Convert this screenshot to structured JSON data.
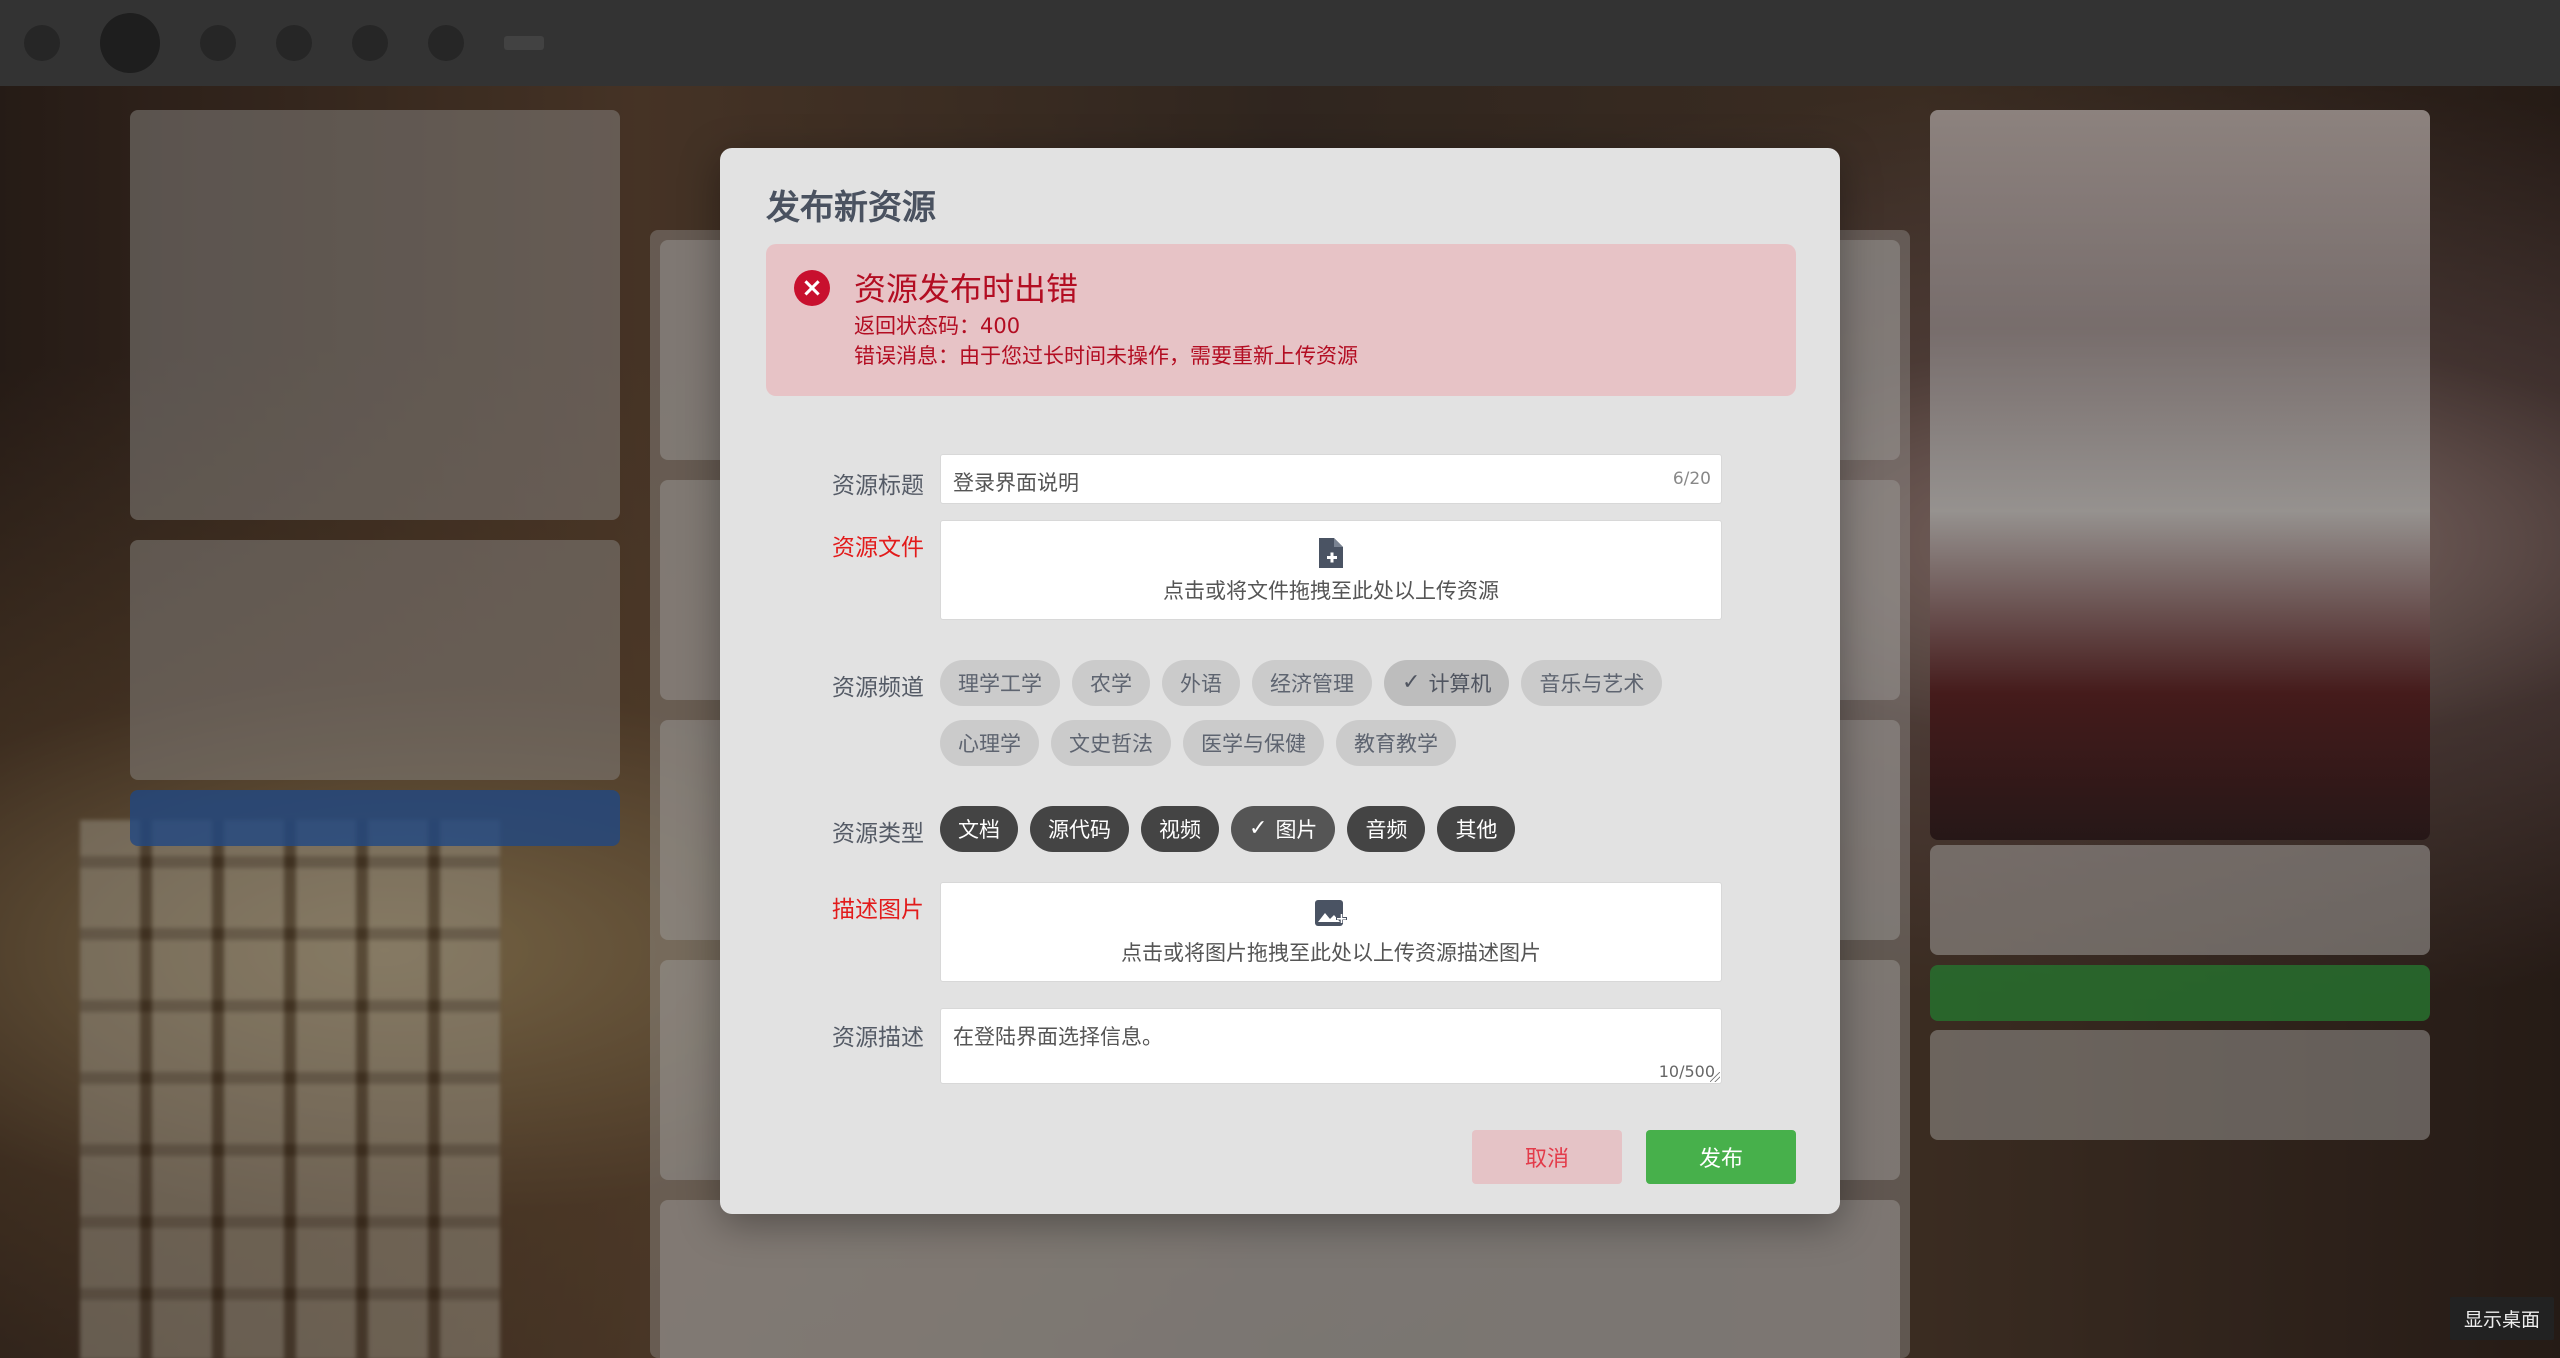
{
  "dialog": {
    "title": "发布新资源"
  },
  "alert": {
    "title": "资源发布时出错",
    "status_line": "返回状态码：400",
    "message_line": "错误消息：由于您过长时间未操作，需要重新上传资源",
    "icon": "error-circle-icon",
    "color": "#b30d22"
  },
  "form": {
    "title_label": "资源标题",
    "title_value": "登录界面说明",
    "title_count": "6/20",
    "file_label": "资源文件",
    "file_upload_text": "点击或将文件拖拽至此处以上传资源",
    "file_icon": "file-plus-icon",
    "channel_label": "资源频道",
    "channels_row1": [
      {
        "label": "理学工学",
        "selected": false
      },
      {
        "label": "农学",
        "selected": false
      },
      {
        "label": "外语",
        "selected": false
      },
      {
        "label": "经济管理",
        "selected": false
      },
      {
        "label": "计算机",
        "selected": true
      },
      {
        "label": "音乐与艺术",
        "selected": false
      }
    ],
    "channels_row2": [
      {
        "label": "心理学",
        "selected": false
      },
      {
        "label": "文史哲法",
        "selected": false
      },
      {
        "label": "医学与保健",
        "selected": false
      },
      {
        "label": "教育教学",
        "selected": false
      }
    ],
    "type_label": "资源类型",
    "types": [
      {
        "label": "文档",
        "selected": false
      },
      {
        "label": "源代码",
        "selected": false
      },
      {
        "label": "视频",
        "selected": false
      },
      {
        "label": "图片",
        "selected": true
      },
      {
        "label": "音频",
        "selected": false
      },
      {
        "label": "其他",
        "selected": false
      }
    ],
    "image_label": "描述图片",
    "image_upload_text": "点击或将图片拖拽至此处以上传资源描述图片",
    "image_icon": "image-plus-icon",
    "desc_label": "资源描述",
    "desc_value": "在登陆界面选择信息。",
    "desc_count": "10/500"
  },
  "actions": {
    "cancel_label": "取消",
    "publish_label": "发布",
    "publish_color": "#47b04b"
  },
  "taskbar": {
    "show_desktop": "显示桌面"
  }
}
